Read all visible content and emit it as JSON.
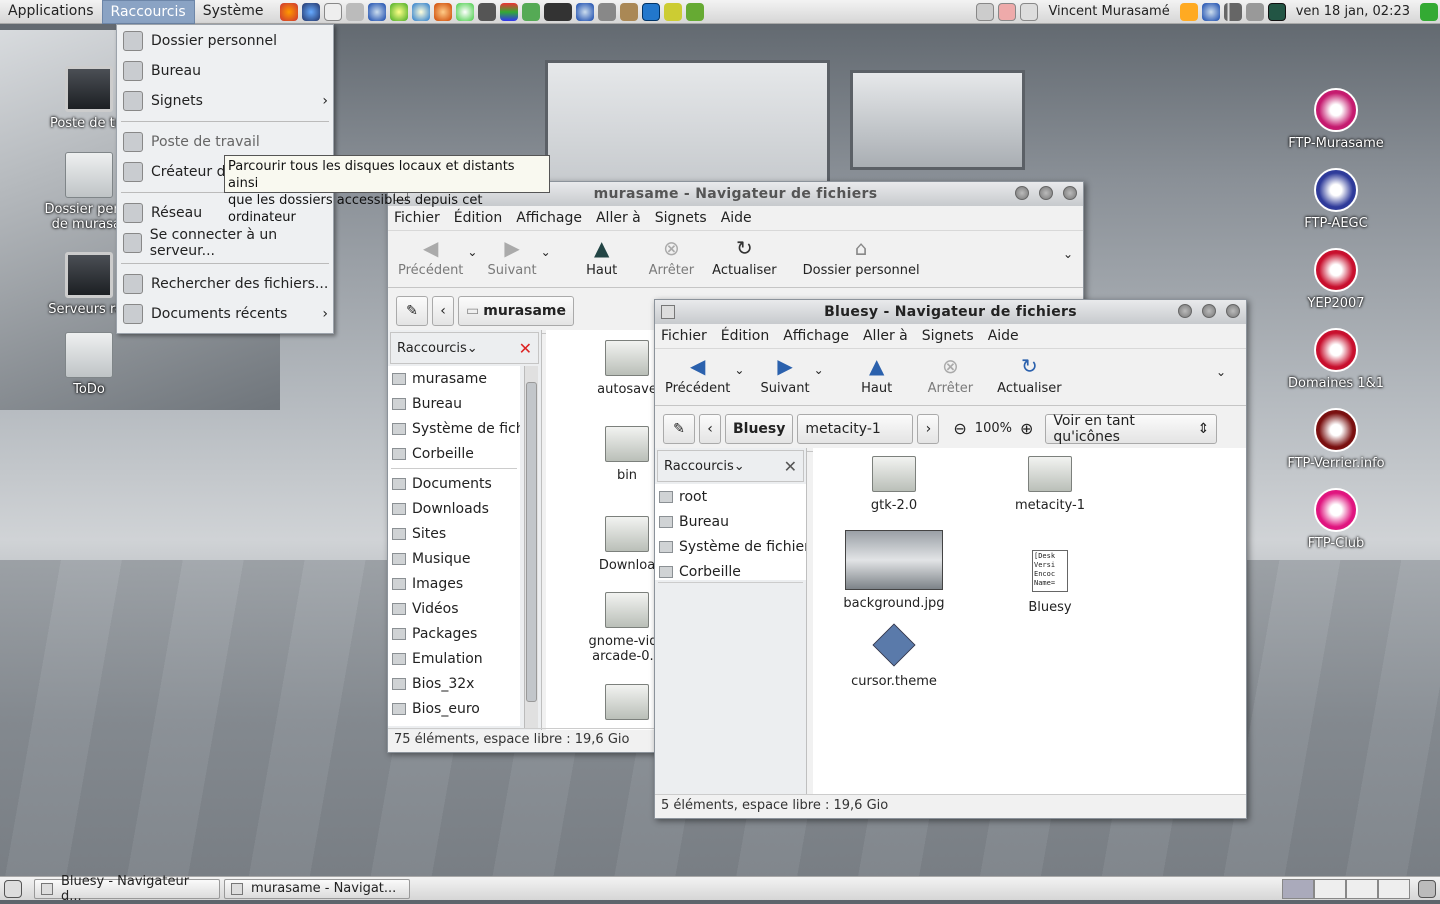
{
  "top_panel": {
    "menus": [
      "Applications",
      "Raccourcis",
      "Système"
    ],
    "user": "Vincent Murasamé",
    "clock": "ven 18 jan, 02:23"
  },
  "desktop_icons_left": [
    {
      "label": "Poste de tra"
    },
    {
      "label": "Dossier perso de murasar"
    },
    {
      "label": "Serveurs rés"
    },
    {
      "label": "ToDo"
    }
  ],
  "desktop_icons_right": [
    {
      "label": "FTP-Murasame",
      "color": "#c51b6f"
    },
    {
      "label": "FTP-AEGC",
      "color": "#2f3b9a"
    },
    {
      "label": "YEP2007",
      "color": "#c8102e"
    },
    {
      "label": "Domaines 1&1",
      "color": "#c8102e"
    },
    {
      "label": "FTP-Verrier.info",
      "color": "#7a1010"
    },
    {
      "label": "FTP-Club",
      "color": "#e0157f"
    }
  ],
  "places_menu": {
    "items": [
      {
        "label": "Dossier personnel",
        "arrow": ""
      },
      {
        "label": "Bureau",
        "arrow": ""
      },
      {
        "label": "Signets",
        "arrow": "›"
      },
      {
        "label": "Poste de travail",
        "arrow": ""
      },
      {
        "label": "Créateur de",
        "arrow": ""
      },
      {
        "label": "Réseau",
        "arrow": ""
      },
      {
        "label": "Se connecter à un serveur...",
        "arrow": ""
      },
      {
        "label": "Rechercher des fichiers...",
        "arrow": ""
      },
      {
        "label": "Documents récents",
        "arrow": "›"
      }
    ],
    "tooltip_line1": "Parcourir tous les disques locaux et distants ainsi",
    "tooltip_line2": "que les dossiers accessibles depuis cet ordinateur"
  },
  "win_murasame": {
    "title": "murasame - Navigateur de fichiers",
    "menu": [
      "Fichier",
      "Édition",
      "Affichage",
      "Aller à",
      "Signets",
      "Aide"
    ],
    "toolbar": {
      "back": "Précédent",
      "forward": "Suivant",
      "up": "Haut",
      "stop": "Arrêter",
      "reload": "Actualiser",
      "home": "Dossier personnel"
    },
    "path": "murasame",
    "sidebar_title": "Raccourcis",
    "sidebar": [
      "murasame",
      "Bureau",
      "Système de fichi",
      "Corbeille",
      "Documents",
      "Downloads",
      "Sites",
      "Musique",
      "Images",
      "Vidéos",
      "Packages",
      "Emulation",
      "Bios_32x",
      "Bios_euro",
      "Bios_jap"
    ],
    "files": [
      "autosave",
      "bin",
      "Downloa",
      "gnome-vide arcade-0.5",
      ""
    ],
    "status": "75 éléments, espace libre : 19,6 Gio"
  },
  "win_bluesy": {
    "title": "Bluesy - Navigateur de fichiers",
    "menu": [
      "Fichier",
      "Édition",
      "Affichage",
      "Aller à",
      "Signets",
      "Aide"
    ],
    "toolbar": {
      "back": "Précédent",
      "forward": "Suivant",
      "up": "Haut",
      "stop": "Arrêter",
      "reload": "Actualiser"
    },
    "path": [
      "Bluesy",
      "metacity-1"
    ],
    "zoom": "100%",
    "view_mode": "Voir en tant qu'icônes",
    "sidebar_title": "Raccourcis",
    "sidebar": [
      "root",
      "Bureau",
      "Système de fichiers",
      "Corbeille"
    ],
    "files": [
      "gtk-2.0",
      "metacity-1",
      "background.jpg",
      "Bluesy",
      "cursor.theme"
    ],
    "status": "5 éléments, espace libre : 19,6 Gio"
  },
  "taskbar": [
    "Bluesy - Navigateur d...",
    "murasame - Navigat..."
  ]
}
